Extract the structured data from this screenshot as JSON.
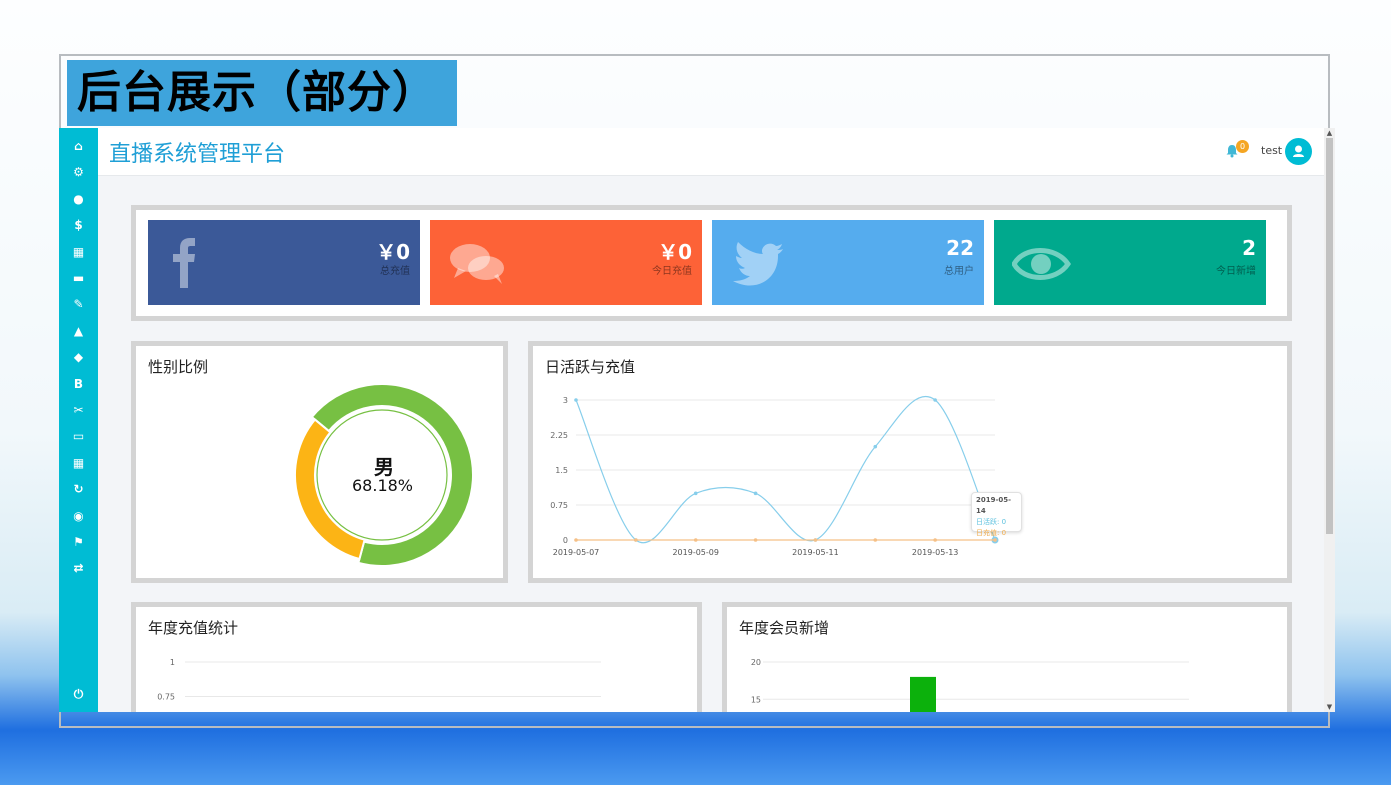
{
  "slide": {
    "title": "后台展示（部分）"
  },
  "header": {
    "app_title": "直播系统管理平台",
    "notification_count": "0",
    "username": "test"
  },
  "sidebar": {
    "icons": [
      "home-icon",
      "cogs-icon",
      "user-icon",
      "dollar-icon",
      "gift-icon",
      "monitor-icon",
      "paperclip-icon",
      "warning-icon",
      "piggy-bank-icon",
      "bitcoin-icon",
      "wrench-icon",
      "folder-icon",
      "grid-icon",
      "refresh-icon",
      "globe-icon",
      "flag-icon",
      "retweet-icon",
      "power-icon"
    ],
    "glyphs": [
      "⌂",
      "⚙",
      "●",
      "$",
      "▦",
      "▬",
      "✎",
      "▲",
      "◆",
      "B",
      "✂",
      "▭",
      "▦",
      "↻",
      "◉",
      "⚑",
      "⇄",
      "⏻"
    ]
  },
  "stats": [
    {
      "value": "￥0",
      "label": "总充值",
      "color": "#3b5998",
      "icon": "facebook-icon"
    },
    {
      "value": "￥0",
      "label": "今日充值",
      "color": "#fd6237",
      "icon": "comments-icon"
    },
    {
      "value": "22",
      "label": "总用户",
      "color": "#55acee",
      "icon": "twitter-icon"
    },
    {
      "value": "2",
      "label": "今日新增",
      "color": "#00a98d",
      "icon": "eye-icon"
    }
  ],
  "gender": {
    "title": "性别比例",
    "center_name": "男",
    "center_pct": "68.18%",
    "male_fraction": 0.6818,
    "male_color": "#77c043",
    "female_color": "#fcb415"
  },
  "chart_data": [
    {
      "type": "line",
      "title": "日活跃与充值",
      "x": [
        "2019-05-07",
        "2019-05-08",
        "2019-05-09",
        "2019-05-10",
        "2019-05-11",
        "2019-05-12",
        "2019-05-13",
        "2019-05-14"
      ],
      "x_tick_labels": [
        "2019-05-07",
        "2019-05-09",
        "2019-05-11",
        "2019-05-13"
      ],
      "yticks": [
        "0",
        "0.75",
        "1.5",
        "2.25",
        "3"
      ],
      "ylim": [
        0,
        3
      ],
      "series": [
        {
          "name": "日活跃",
          "values": [
            3,
            0,
            1,
            1,
            0,
            2,
            3,
            0
          ],
          "color": "#87ceeb"
        },
        {
          "name": "日充值",
          "values": [
            0,
            0,
            0,
            0,
            0,
            0,
            0,
            0
          ],
          "color": "#f5c087"
        }
      ],
      "tooltip": {
        "date": "2019-05-14",
        "line1": "日活跃: 0",
        "line2": "日充值: 0"
      },
      "grid": true
    },
    {
      "type": "line",
      "title": "年度充值统计",
      "yticks": [
        "1",
        "0.75"
      ],
      "ylim": [
        0,
        1
      ],
      "grid": true
    },
    {
      "type": "bar",
      "title": "年度会员新增",
      "yticks": [
        "20",
        "15"
      ],
      "ylim": [
        0,
        20
      ],
      "values": [
        18
      ],
      "color": "#0cb10c",
      "grid": true
    }
  ]
}
